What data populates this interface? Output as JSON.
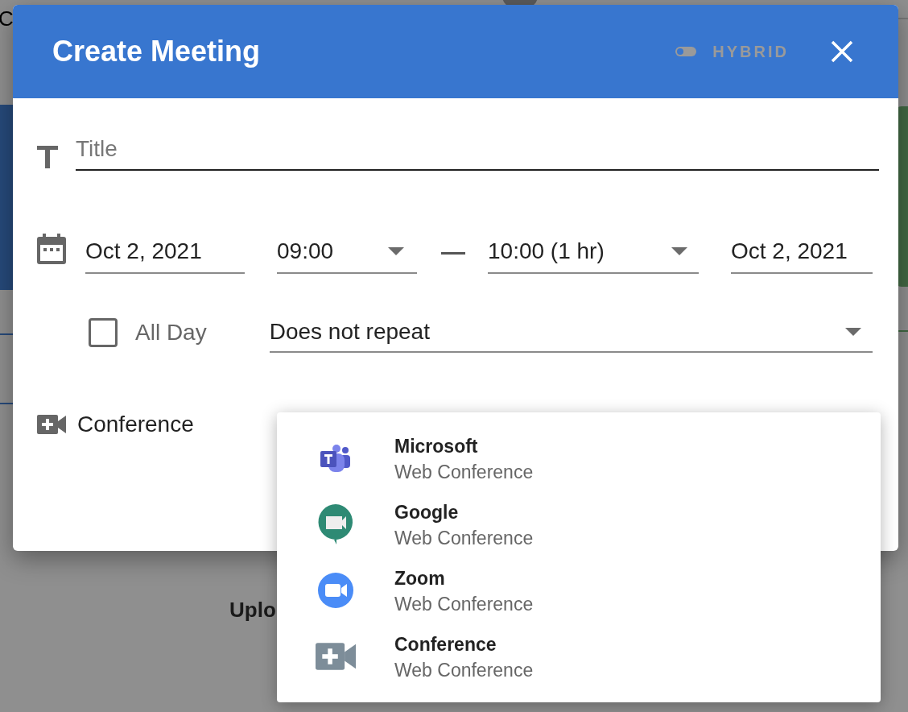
{
  "background": {
    "texts": [
      "C",
      "Uplo"
    ]
  },
  "dialog": {
    "title": "Create Meeting",
    "hybrid": {
      "label": "HYBRID",
      "on": false
    },
    "title_field": {
      "placeholder": "Title"
    },
    "start_date": "Oct 2, 2021",
    "start_time": "09:00",
    "end_time": "10:00 (1 hr)",
    "end_date": "Oct 2, 2021",
    "all_day": {
      "label": "All Day",
      "checked": false
    },
    "repeat": "Does not repeat",
    "conference_label": "Conference"
  },
  "conference_menu": [
    {
      "kind": "teams",
      "name": "Microsoft",
      "subtitle": "Web Conference"
    },
    {
      "kind": "meet",
      "name": "Google",
      "subtitle": "Web Conference"
    },
    {
      "kind": "zoom",
      "name": "Zoom",
      "subtitle": "Web Conference"
    },
    {
      "kind": "generic",
      "name": "Conference",
      "subtitle": "Web Conference"
    }
  ]
}
